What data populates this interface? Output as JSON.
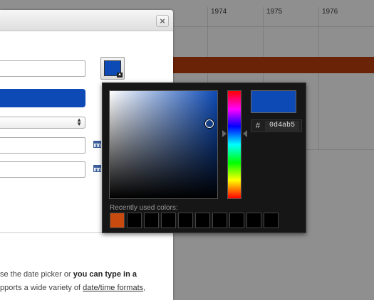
{
  "timeline": {
    "years": [
      "1974",
      "1975",
      "1976"
    ]
  },
  "dialog": {
    "close_icon": "close-icon",
    "calendar_icon": "calendar-icon",
    "help_text": {
      "line1_prefix": "se the date picker or ",
      "line1_bold": "you can type in a",
      "line2_prefix": "pports a wide variety of ",
      "line2_link": "date/time formats",
      "line2_suffix": ","
    }
  },
  "color_picker": {
    "current_color": "#0d4ab5",
    "hex_label": "#",
    "hex_value": "0d4ab5",
    "recent_label": "Recently used colors:",
    "recent_colors": [
      "#c84a0f",
      "#000000",
      "#000000",
      "#000000",
      "#000000",
      "#000000",
      "#000000",
      "#000000",
      "#000000",
      "#000000"
    ]
  },
  "colors": {
    "accent_blue": "#0d4ab5",
    "timeline_bar": "#6b2307"
  }
}
